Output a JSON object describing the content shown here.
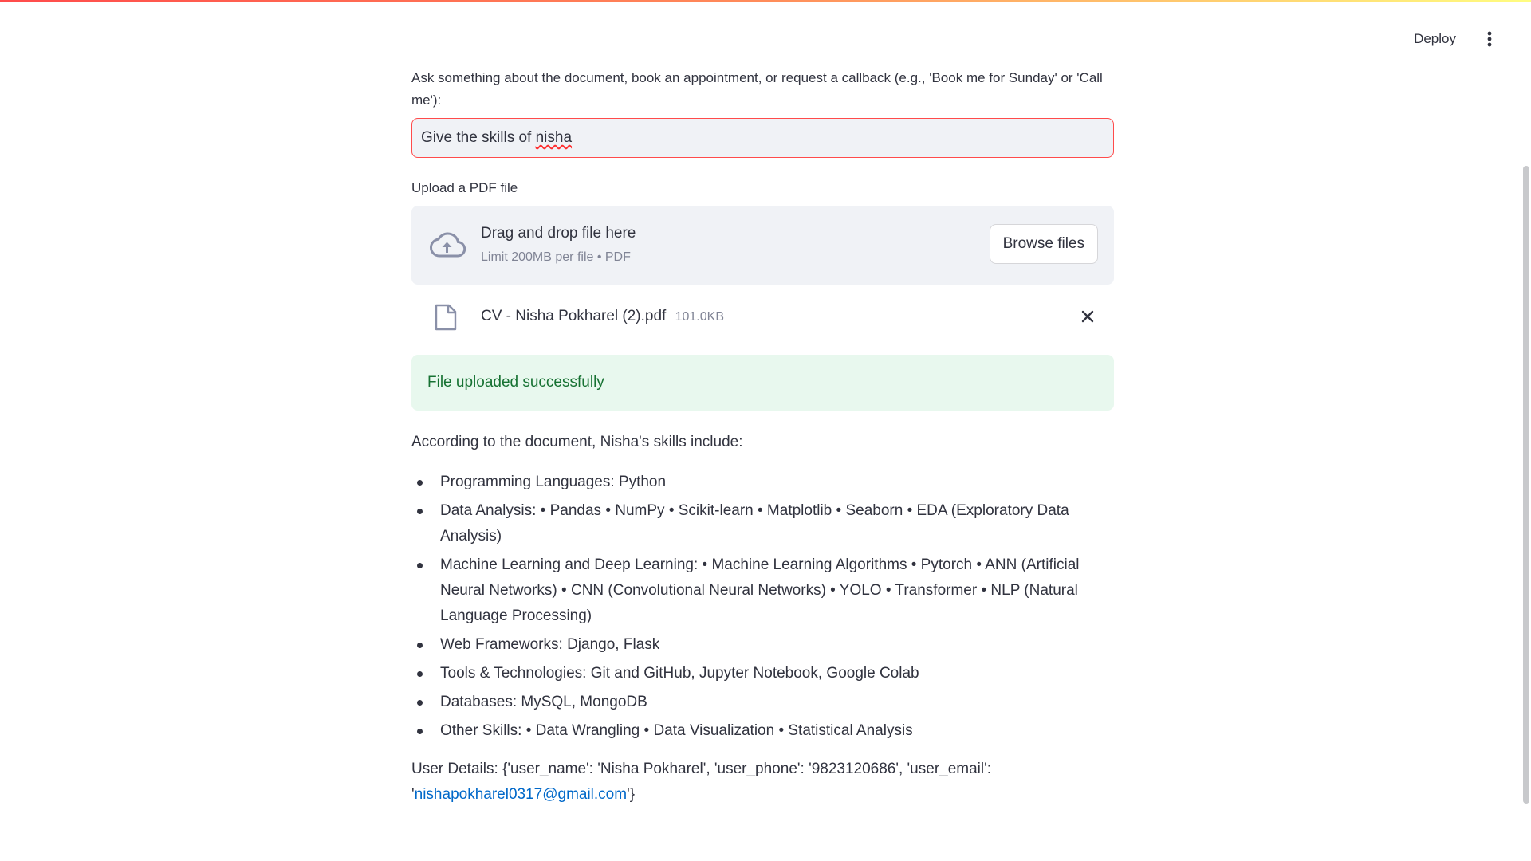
{
  "header": {
    "deploy_label": "Deploy",
    "menu_icon": "vertical-dots-icon"
  },
  "query": {
    "label": "Ask something about the document, book an appointment, or request a callback (e.g., 'Book me for Sunday' or 'Call me'):",
    "value_prefix": "Give the skills of ",
    "value_misspelled": "nisha",
    "focus_color": "#ff4b4b"
  },
  "uploader": {
    "label": "Upload a PDF file",
    "drop_title": "Drag and drop file here",
    "limit_text": "Limit 200MB per file • PDF",
    "browse_label": "Browse files",
    "icon": "cloud-upload-icon"
  },
  "uploaded_file": {
    "name": "CV - Nisha Pokharel (2).pdf",
    "size": "101.0KB",
    "icon": "file-icon",
    "remove_icon": "close-icon"
  },
  "status": {
    "message": "File uploaded successfully",
    "color": "#177233",
    "background": "#e8f8ee"
  },
  "answer": {
    "intro": "According to the document, Nisha's skills include:",
    "skills": [
      "Programming Languages: Python",
      "Data Analysis: • Pandas • NumPy • Scikit-learn • Matplotlib • Seaborn • EDA (Exploratory Data Analysis)",
      "Machine Learning and Deep Learning: • Machine Learning Algorithms • Pytorch • ANN (Artificial Neural Networks) • CNN (Convolutional Neural Networks) • YOLO • Transformer • NLP (Natural Language Processing)",
      "Web Frameworks: Django, Flask",
      "Tools & Technologies: Git and GitHub, Jupyter Notebook, Google Colab",
      "Databases: MySQL, MongoDB",
      "Other Skills: • Data Wrangling • Data Visualization • Statistical Analysis"
    ],
    "user_details_prefix": "User Details: {'user_name': 'Nisha Pokharel', 'user_phone': '9823120686', 'user_email': '",
    "user_email": "nishapokharel0317@gmail.com",
    "user_details_suffix": "'}"
  }
}
